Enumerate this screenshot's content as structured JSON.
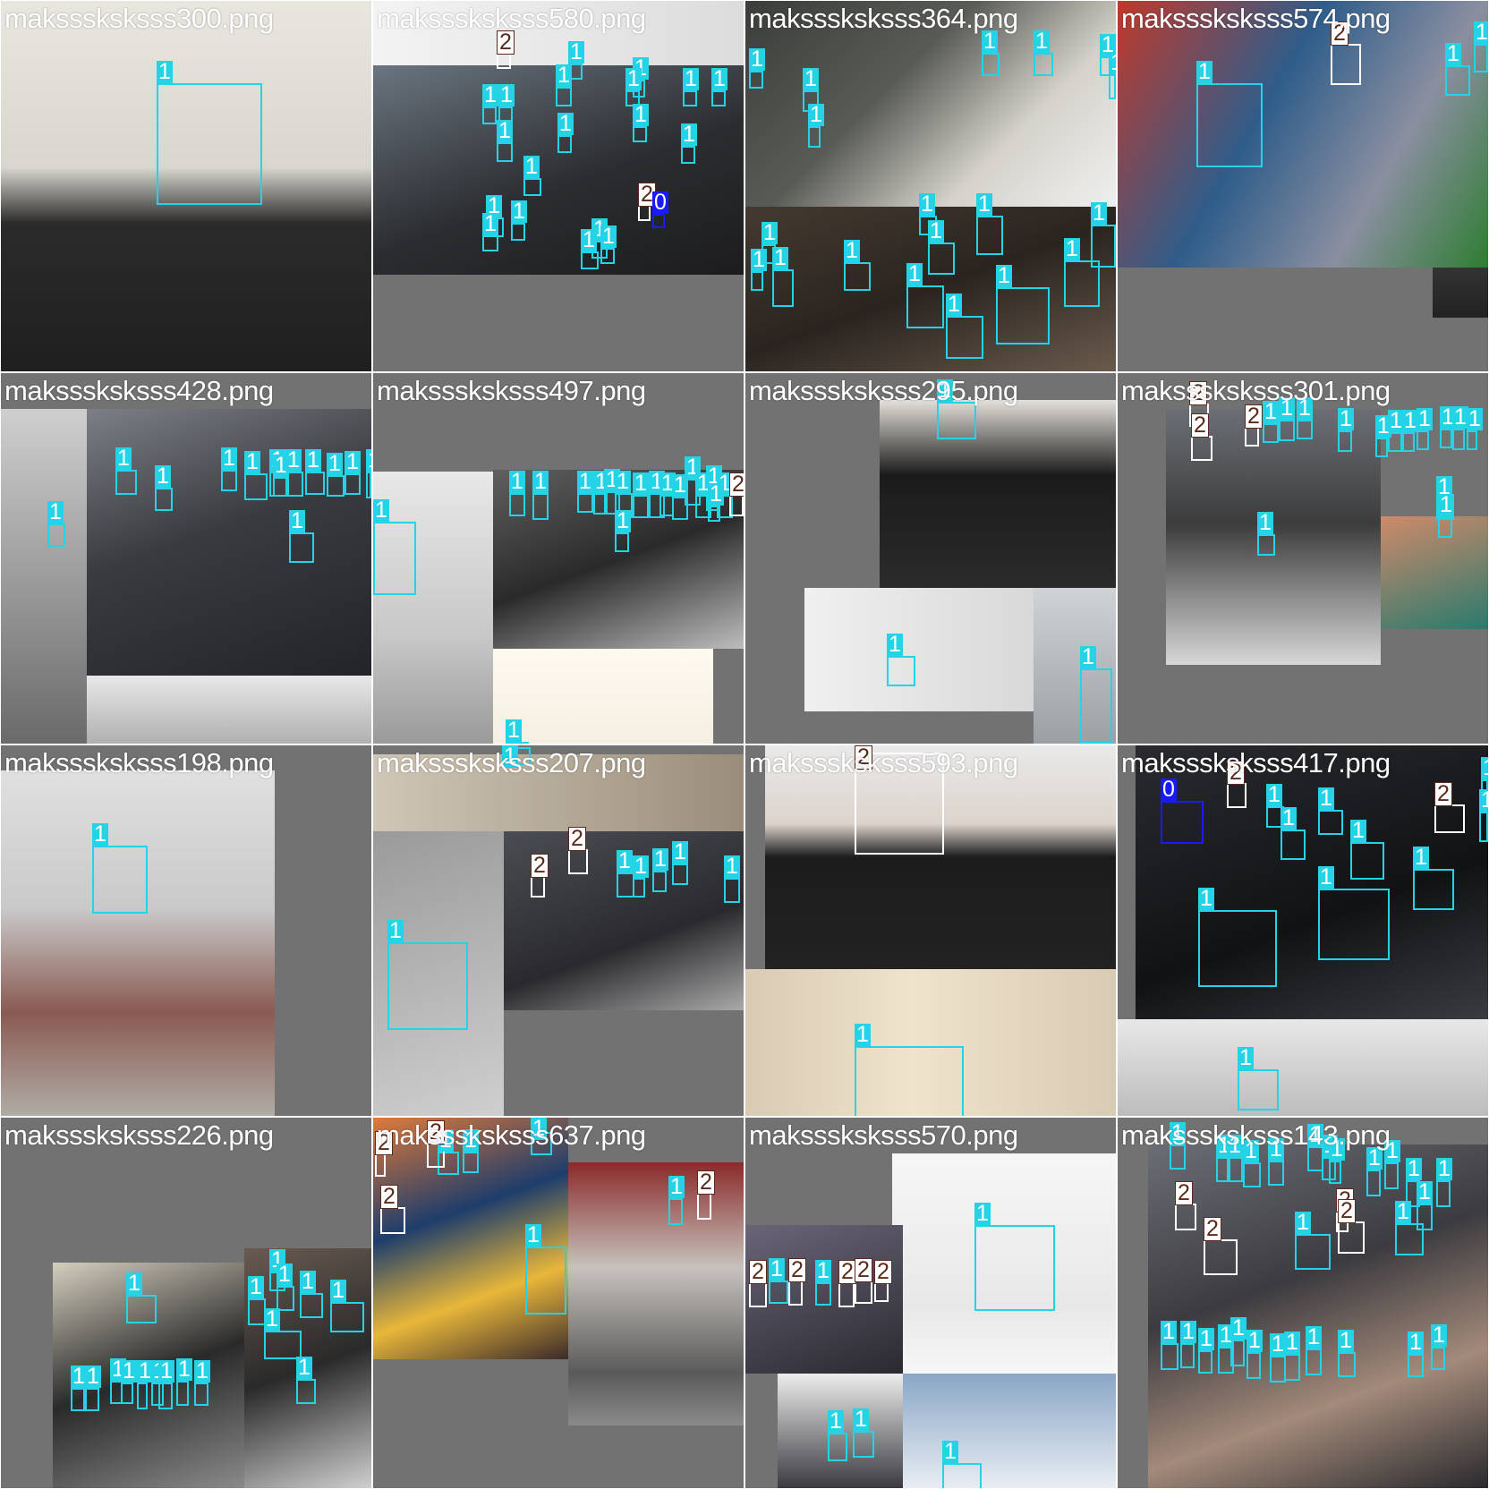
{
  "image": {
    "kind": "YOLO training batch mosaic (4x4 grid, face-mask detection labels)",
    "background_fill": "#727272",
    "class_colors": {
      "0": "#1a1aff",
      "1": "#25d3e6",
      "2": "#ffffff"
    },
    "class_label_text_colors": {
      "0": "#ffffff",
      "1": "#ffffff",
      "2": "#5a2a1a"
    }
  },
  "tiles": [
    {
      "filename": "maksssksksss300.png",
      "labels": [
        "1"
      ]
    },
    {
      "filename": "maksssksksss580.png",
      "labels": [
        "2",
        "1",
        "1",
        "1",
        "1",
        "1",
        "1",
        "1",
        "1",
        "1",
        "1",
        "1",
        "1",
        "1",
        "1",
        "2",
        "0",
        "1",
        "1",
        "1",
        "1",
        "1"
      ]
    },
    {
      "filename": "maksssksksss364.png",
      "labels": [
        "1",
        "1",
        "1",
        "1",
        "1",
        "1",
        "1",
        "1",
        "1",
        "1",
        "1",
        "1",
        "1",
        "1",
        "1",
        "1",
        "1",
        "1",
        "1"
      ]
    },
    {
      "filename": "maksssksksss574.png",
      "labels": [
        "2",
        "1",
        "1",
        "1"
      ]
    },
    {
      "filename": "maksssksksss428.png",
      "labels": [
        "1",
        "1",
        "1",
        "1",
        "1",
        "1",
        "1",
        "1",
        "1",
        "1",
        "1",
        "1",
        "1"
      ]
    },
    {
      "filename": "maksssksksss497.png",
      "labels": [
        "1",
        "1",
        "1",
        "1",
        "1",
        "1",
        "1",
        "1",
        "1",
        "1",
        "1",
        "1",
        "1",
        "1",
        "1",
        "2",
        "1",
        "1",
        "1"
      ]
    },
    {
      "filename": "maksssksksss295.png",
      "labels": [
        "1",
        "1",
        "1"
      ]
    },
    {
      "filename": "maksssksksss301.png",
      "labels": [
        "2",
        "2",
        "2",
        "1",
        "1",
        "1",
        "1",
        "1",
        "1",
        "1",
        "1",
        "1",
        "1",
        "1",
        "1",
        "1",
        "1"
      ]
    },
    {
      "filename": "maksssksksss198.png",
      "labels": [
        "1"
      ]
    },
    {
      "filename": "maksssksksss207.png",
      "labels": [
        "1",
        "2",
        "2",
        "1",
        "1",
        "1",
        "1",
        "1",
        "1"
      ]
    },
    {
      "filename": "maksssksksss593.png",
      "labels": [
        "2",
        "1"
      ]
    },
    {
      "filename": "maksssksksss417.png",
      "labels": [
        "0",
        "2",
        "2",
        "1",
        "1",
        "1",
        "1",
        "1",
        "1",
        "1",
        "1",
        "1",
        "1"
      ]
    },
    {
      "filename": "maksssksksss226.png",
      "labels": [
        "1",
        "1",
        "1",
        "1",
        "1",
        "1",
        "1",
        "1",
        "1",
        "1",
        "1",
        "1",
        "1",
        "1",
        "1",
        "1",
        "1"
      ]
    },
    {
      "filename": "maksssksksss637.png",
      "labels": [
        "2",
        "1",
        "1",
        "1",
        "2",
        "1",
        "1",
        "2",
        "2"
      ]
    },
    {
      "filename": "maksssksksss570.png",
      "labels": [
        "1",
        "2",
        "1",
        "2",
        "1",
        "2",
        "2",
        "2",
        "1",
        "1",
        "1"
      ]
    },
    {
      "filename": "maksssksksss143.png",
      "labels": [
        "1",
        "1",
        "1",
        "1",
        "1",
        "1",
        "1",
        "1",
        "2",
        "2",
        "2",
        "2",
        "1",
        "1",
        "1",
        "1",
        "1",
        "1",
        "1",
        "1",
        "1",
        "1",
        "1",
        "1",
        "1",
        "1",
        "1",
        "1",
        "1",
        "1",
        "1"
      ]
    }
  ]
}
